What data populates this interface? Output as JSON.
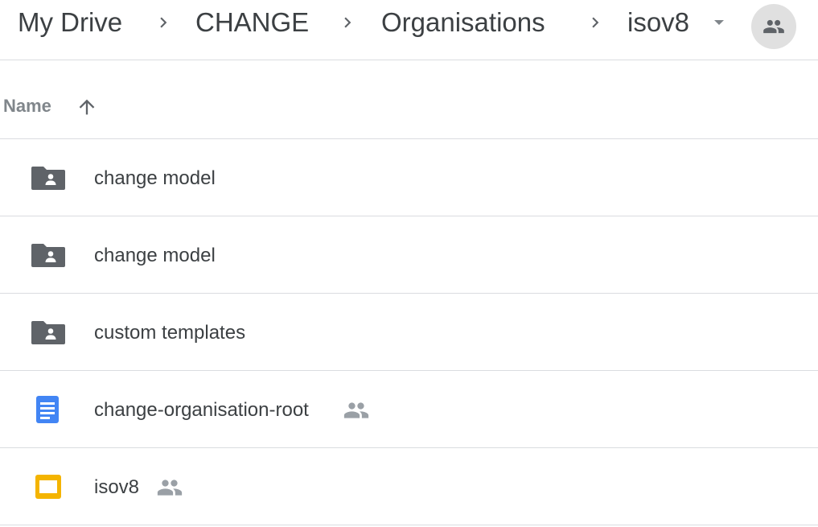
{
  "breadcrumb": {
    "items": [
      {
        "label": "My Drive"
      },
      {
        "label": "CHANGE"
      },
      {
        "label": "Organisations"
      },
      {
        "label": "isov8"
      }
    ],
    "separator_icon": "chevron-right-icon",
    "dropdown_icon": "caret-down-icon",
    "shared_icon": "people-icon"
  },
  "list_header": {
    "column_label": "Name",
    "sort_icon": "arrow-up-icon"
  },
  "files": [
    {
      "name": "change model",
      "icon": "shared-folder-icon",
      "shared": false
    },
    {
      "name": "change model",
      "icon": "shared-folder-icon",
      "shared": false
    },
    {
      "name": "custom templates",
      "icon": "shared-folder-icon",
      "shared": false
    },
    {
      "name": "change-organisation-root",
      "icon": "google-docs-icon",
      "shared": true
    },
    {
      "name": "isov8",
      "icon": "google-slides-icon",
      "shared": true
    }
  ],
  "colors": {
    "folder": "#5f6368",
    "docs_blue": "#4285f4",
    "slides_yellow": "#f4b400",
    "divider": "#dadce0",
    "shared_badge_bg": "#e0e0e0"
  }
}
